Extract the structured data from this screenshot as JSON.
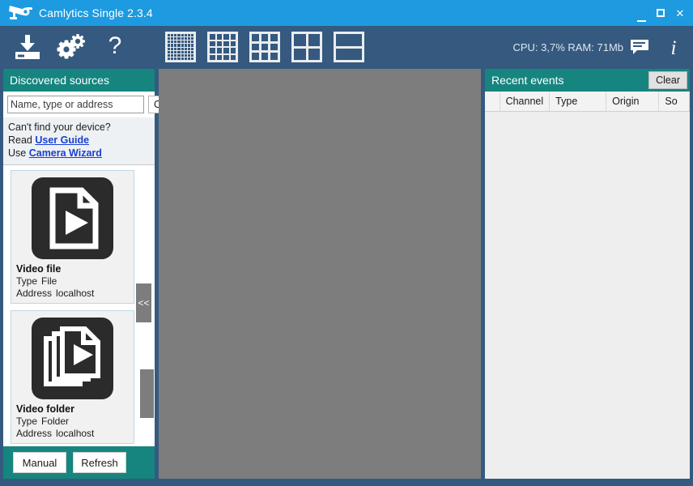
{
  "window": {
    "title": "Camlytics Single 2.3.4",
    "logo_icon": "security-camera-icon",
    "minimize": "minimize-icon",
    "maximize": "maximize-icon",
    "close": "close-icon",
    "close_glyph": "✕"
  },
  "toolbar": {
    "icons": [
      {
        "name": "download-icon",
        "label": "Install"
      },
      {
        "name": "settings-gears-icon",
        "label": "Settings"
      },
      {
        "name": "help-question-icon",
        "label": "Help"
      }
    ],
    "layouts": [
      {
        "name": "layout-8x8-icon",
        "cells": 64,
        "cls": "lay-8"
      },
      {
        "name": "layout-4x4-icon",
        "cells": 16,
        "cls": "lay-4"
      },
      {
        "name": "layout-3x3-icon",
        "cells": 9,
        "cls": "lay-3"
      },
      {
        "name": "layout-2x2-icon",
        "cells": 4,
        "cls": "lay-2"
      },
      {
        "name": "layout-2x1-icon",
        "cells": 2,
        "cls": "lay-1"
      }
    ],
    "status": "CPU: 3,7% RAM: 71Mb",
    "feedback_icon": "speech-bubble-icon",
    "info_icon": "info-icon",
    "info_glyph": "i"
  },
  "left_panel": {
    "header": "Discovered sources",
    "search": {
      "placeholder": "Name, type or address",
      "value": ""
    },
    "clear_label": "Clear",
    "help": {
      "question": "Can't find your device?",
      "read_prefix": "Read",
      "read_link": "User Guide",
      "use_prefix": "Use",
      "use_link": "Camera Wizard"
    },
    "sources": [
      {
        "title": "Video file",
        "icon": "video-file-icon",
        "type_label": "Type",
        "type_value": "File",
        "address_label": "Address",
        "address_value": "localhost"
      },
      {
        "title": "Video folder",
        "icon": "video-folder-icon",
        "type_label": "Type",
        "type_value": "Folder",
        "address_label": "Address",
        "address_value": "localhost"
      }
    ],
    "collapse_label": "<<",
    "footer": {
      "manual_label": "Manual",
      "refresh_label": "Refresh"
    }
  },
  "right_panel": {
    "header": "Recent events",
    "clear_label": "Clear",
    "columns": [
      "",
      "Channel",
      "Type",
      "Origin",
      "So"
    ],
    "rows": []
  },
  "colors": {
    "titlebar": "#1e9ae0",
    "toolbar": "#35597f",
    "frame": "#355a80",
    "panel_header": "#16857f",
    "viewport": "#7d7d7d",
    "link": "#1a3fd0"
  }
}
